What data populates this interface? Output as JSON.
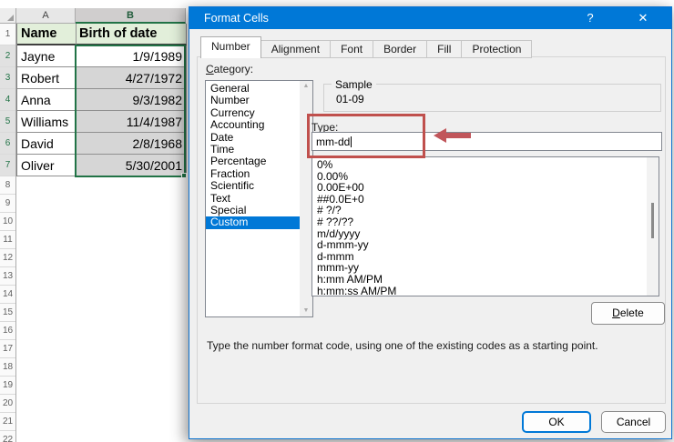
{
  "colors": {
    "titlebar_blue": "#0078D7",
    "excel_green": "#217346",
    "header_fill_green": "#E2EFDA",
    "selection_fill_gray": "#D6D6D6",
    "annotation_red": "#C0504D",
    "dialog_bg": "#F0F0F0"
  },
  "spreadsheet": {
    "col_headers": [
      "A",
      "B"
    ],
    "header_row": {
      "number": "1",
      "name_header": "Name",
      "date_header": "Birth of date"
    },
    "rows": [
      {
        "number": "2",
        "name": "Jayne",
        "date": "1/9/1989",
        "active": true
      },
      {
        "number": "3",
        "name": "Robert",
        "date": "4/27/1972"
      },
      {
        "number": "4",
        "name": "Anna",
        "date": "9/3/1982"
      },
      {
        "number": "5",
        "name": "Williams",
        "date": "11/4/1987"
      },
      {
        "number": "6",
        "name": "David",
        "date": "2/8/1968"
      },
      {
        "number": "7",
        "name": "Oliver",
        "date": "5/30/2001"
      }
    ],
    "empty_rows": [
      "8",
      "9",
      "10",
      "11",
      "12",
      "13",
      "14",
      "15",
      "16",
      "17",
      "18",
      "19",
      "20",
      "21",
      "22"
    ]
  },
  "dialog": {
    "title": "Format Cells",
    "help_label": "?",
    "close_label": "✕",
    "tabs": [
      {
        "label": "Number",
        "active": true
      },
      {
        "label": "Alignment"
      },
      {
        "label": "Font"
      },
      {
        "label": "Border"
      },
      {
        "label": "Fill"
      },
      {
        "label": "Protection"
      }
    ],
    "category_label": {
      "accel": "C",
      "rest": "ategory:"
    },
    "category_items": [
      {
        "label": "General"
      },
      {
        "label": "Number"
      },
      {
        "label": "Currency"
      },
      {
        "label": "Accounting"
      },
      {
        "label": "Date"
      },
      {
        "label": "Time"
      },
      {
        "label": "Percentage"
      },
      {
        "label": "Fraction"
      },
      {
        "label": "Scientific"
      },
      {
        "label": "Text"
      },
      {
        "label": "Special"
      },
      {
        "label": "Custom",
        "selected": true
      }
    ],
    "scroll_up_icon": "▲",
    "scroll_down_icon": "▼",
    "sample": {
      "label": "Sample",
      "value": "01-09"
    },
    "type_label": {
      "accel": "T",
      "rest": "ype:"
    },
    "type_value": "mm-dd",
    "codes": [
      "0%",
      "0.00%",
      "0.00E+00",
      "##0.0E+0",
      "# ?/?",
      "# ??/??",
      "m/d/yyyy",
      "d-mmm-yy",
      "d-mmm",
      "mmm-yy",
      "h:mm AM/PM",
      "h:mm:ss AM/PM"
    ],
    "delete_button": {
      "accel": "D",
      "rest": "elete"
    },
    "description": "Type the number format code, using one of the existing codes as a starting point.",
    "ok_label": "OK",
    "cancel_label": "Cancel"
  }
}
